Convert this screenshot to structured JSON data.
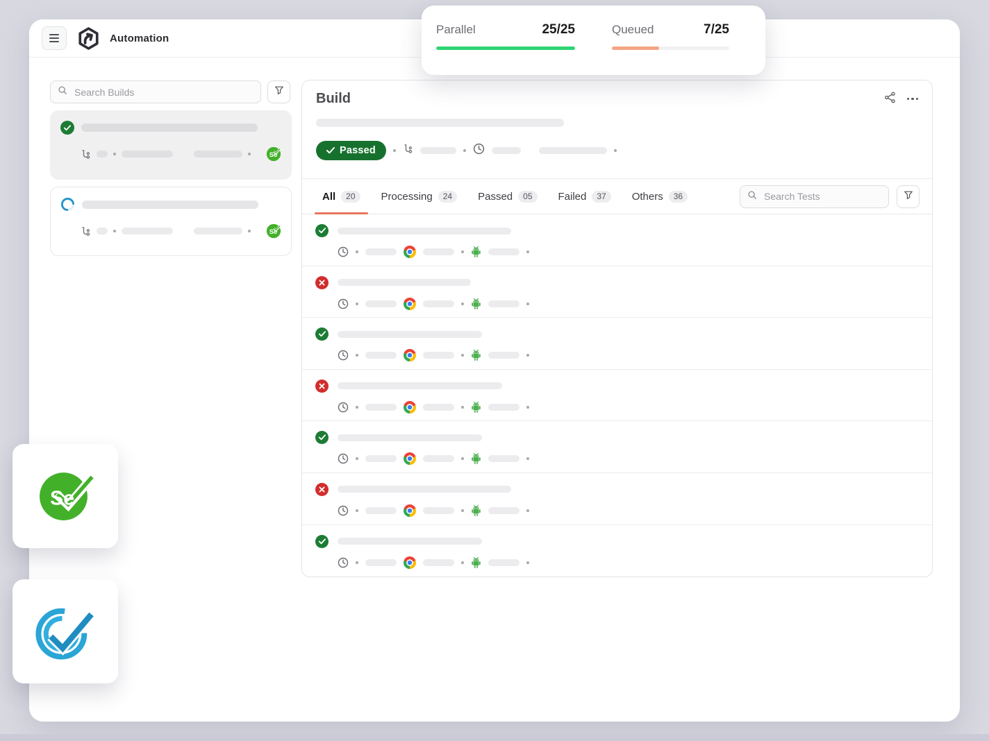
{
  "topbar": {
    "title": "Automation"
  },
  "stats_card": {
    "parallel": {
      "label": "Parallel",
      "value": "25/25",
      "percent": 100,
      "bar_color": "#2ed573"
    },
    "queued": {
      "label": "Queued",
      "value": "7/25",
      "percent": 40,
      "bar_color": "#f4a585"
    }
  },
  "sidebar": {
    "search_placeholder": "Search Builds",
    "builds": [
      {
        "status": "passed",
        "framework": "selenium",
        "framework_badge": "Se",
        "selected": true
      },
      {
        "status": "running",
        "framework": "selenium",
        "framework_badge": "Se",
        "selected": false
      }
    ]
  },
  "main": {
    "title": "Build",
    "status_badge_label": "Passed",
    "search_placeholder": "Search Tests",
    "tabs": [
      {
        "label": "All",
        "count": "20",
        "active": true
      },
      {
        "label": "Processing",
        "count": "24",
        "active": false
      },
      {
        "label": "Passed",
        "count": "05",
        "active": false
      },
      {
        "label": "Failed",
        "count": "37",
        "active": false
      },
      {
        "label": "Others",
        "count": "36",
        "active": false
      }
    ],
    "rows": [
      {
        "status": "passed",
        "title_width": 250
      },
      {
        "status": "failed",
        "title_width": 192
      },
      {
        "status": "passed",
        "title_width": 208
      },
      {
        "status": "failed",
        "title_width": 237
      },
      {
        "status": "passed",
        "title_width": 208
      },
      {
        "status": "failed",
        "title_width": 250
      },
      {
        "status": "passed",
        "title_width": 208
      }
    ],
    "row_meta_icons": [
      "clock-icon",
      "chrome-icon",
      "android-icon"
    ]
  },
  "floating_logos": {
    "selenium_text": "Se"
  },
  "colors": {
    "page_bg": "#d7d8e0",
    "status_green": "#1d7c34",
    "status_red": "#d22d2d",
    "passed_pill_green": "#17712e",
    "selenium_green": "#43b02a",
    "tab_underline_orange": "#e8765a",
    "progress_green": "#2ed573",
    "progress_orange": "#f4a585",
    "spinner_blue": "#2596c8",
    "codecept_blue": "#2aa5d6"
  }
}
